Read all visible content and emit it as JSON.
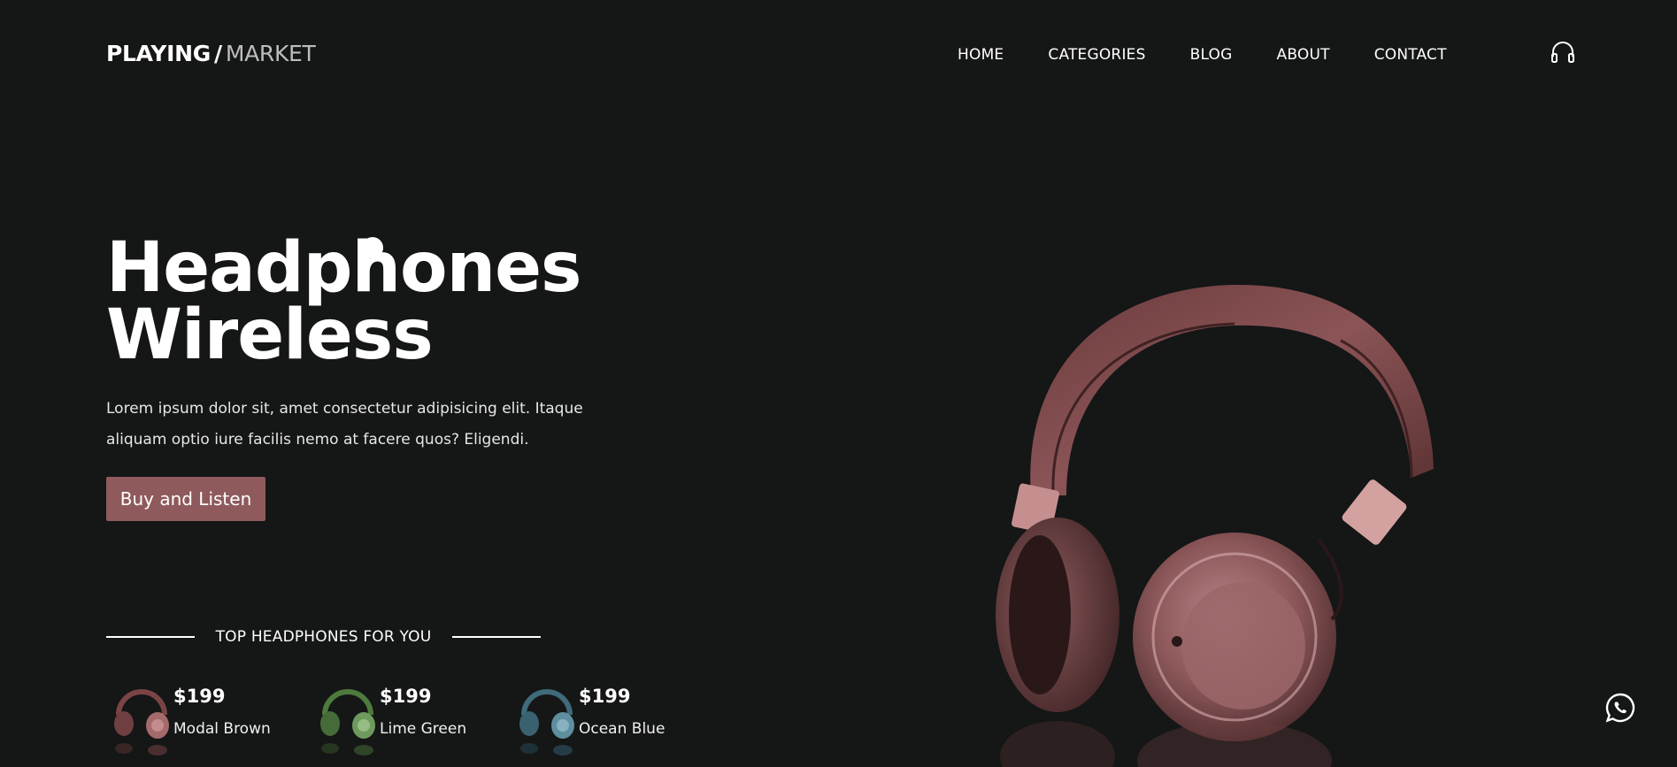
{
  "header": {
    "logo": {
      "brand": "PLAYING",
      "slash": "/",
      "market": "MARKET"
    },
    "nav": [
      {
        "label": "HOME"
      },
      {
        "label": "CATEGORIES"
      },
      {
        "label": "BLOG"
      },
      {
        "label": "ABOUT"
      },
      {
        "label": "CONTACT"
      }
    ],
    "icon": "headphones-icon"
  },
  "hero": {
    "title_line1": "Headphones",
    "title_line2": "Wireless",
    "description": "Lorem ipsum dolor sit, amet consectetur adipisicing elit. Itaque aliquam optio iure facilis nemo at facere quos? Eligendi.",
    "cta_label": "Buy and Listen",
    "image": "headphones-product-image"
  },
  "top_section": {
    "title": "TOP HEADPHONES FOR YOU",
    "products": [
      {
        "price": "$199",
        "name": "Modal Brown",
        "color": "#9a5a5c"
      },
      {
        "price": "$199",
        "name": "Lime Green",
        "color": "#5f8a4f"
      },
      {
        "price": "$199",
        "name": "Ocean Blue",
        "color": "#4f7f8f"
      }
    ]
  },
  "floating": {
    "icon": "whatsapp-icon"
  },
  "colors": {
    "background": "#151616",
    "accent": "#8f5a5c",
    "text": "#ffffff",
    "muted": "#bdbdbd"
  }
}
